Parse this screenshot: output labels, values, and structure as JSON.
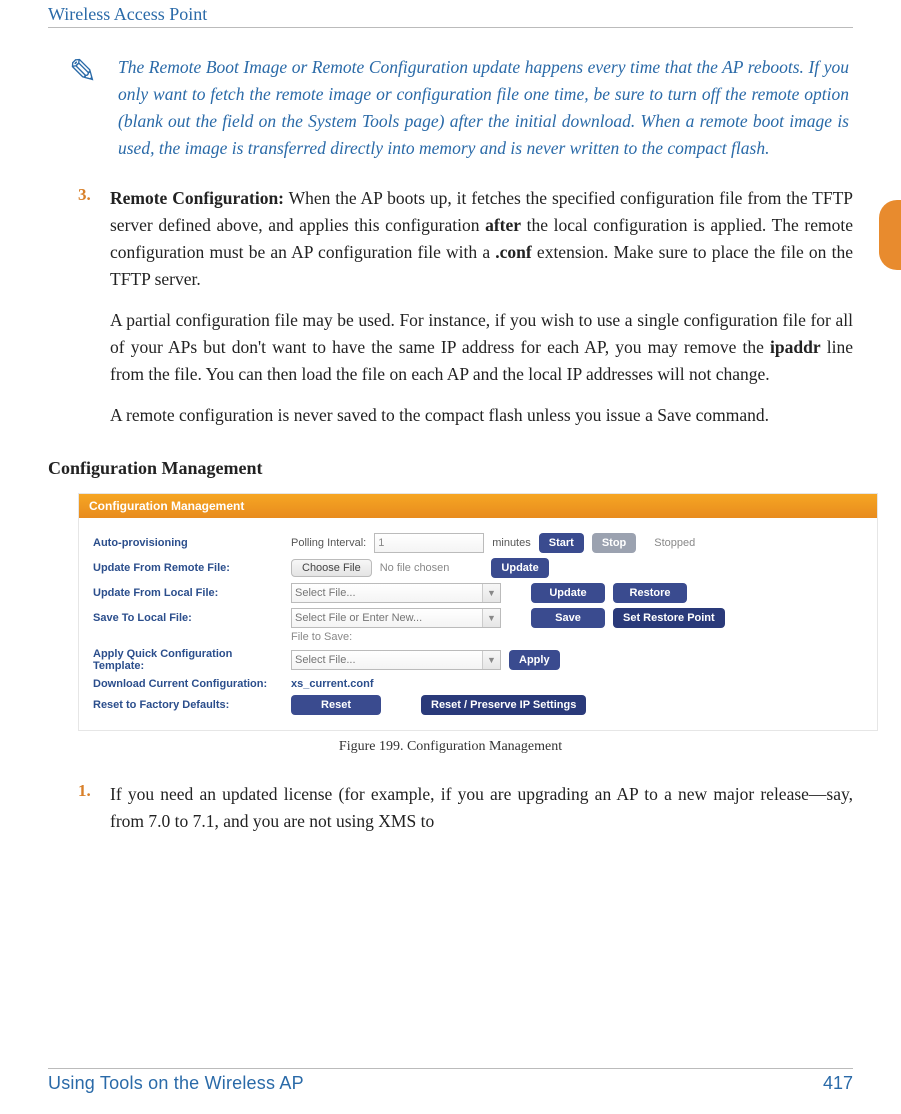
{
  "header": {
    "title": "Wireless Access Point"
  },
  "note": {
    "icon_glyph": "✎",
    "text": "The Remote Boot Image or Remote Configuration update happens every time that the AP reboots. If you only want to fetch the remote image or configuration file one time, be sure to turn off the remote option (blank out the field on the System Tools page) after the initial download. When a remote boot image is used, the image is transferred directly into memory and is never written to the compact flash."
  },
  "item3": {
    "num": "3.",
    "lead": "Remote Configuration:",
    "p1a": " When the AP boots up, it fetches the specified configuration file from the TFTP server defined above, and applies this configuration ",
    "after": "after",
    "p1b": " the local configuration is applied. The remote configuration must be an AP configuration file with a ",
    "conf": ".conf",
    "p1c": " extension. Make sure to place the file on the TFTP server.",
    "p2a": "A partial configuration file may be used. For instance, if you wish to use a single configuration file for all of your APs but don't want to have the same IP address for each AP, you may remove the ",
    "ipaddr": "ipaddr",
    "p2b": " line from the file. You can then load the file on each AP and the local IP addresses will not change.",
    "p3": "A remote configuration is never saved to the compact flash unless you issue a Save command."
  },
  "subhead": "Configuration Management",
  "cm": {
    "panel_title": "Configuration Management",
    "rows": {
      "auto_prov": {
        "label": "Auto-provisioning",
        "polling_label": "Polling Interval:",
        "polling_value": "1",
        "polling_unit": "minutes",
        "start": "Start",
        "stop": "Stop",
        "status": "Stopped"
      },
      "remote": {
        "label": "Update From Remote File:",
        "choose": "Choose File",
        "nofile": "No file chosen",
        "update": "Update"
      },
      "local": {
        "label": "Update From Local File:",
        "placeholder": "Select File...",
        "update": "Update",
        "restore": "Restore"
      },
      "save": {
        "label": "Save To Local File:",
        "placeholder": "Select File or Enter New...",
        "sublabel": "File to Save:",
        "save": "Save",
        "setpoint": "Set Restore Point"
      },
      "apply": {
        "label": "Apply Quick Configuration Template:",
        "placeholder": "Select File...",
        "apply": "Apply"
      },
      "download": {
        "label": "Download Current Configuration:",
        "link": "xs_current.conf"
      },
      "reset": {
        "label": "Reset to Factory Defaults:",
        "reset": "Reset",
        "preserve": "Reset / Preserve IP Settings"
      }
    }
  },
  "figcap": "Figure 199. Configuration Management",
  "item1": {
    "num": "1.",
    "text": "If you need an updated license (for example, if you are upgrading an AP to a new major release—say, from 7.0 to 7.1, and you are not using XMS to"
  },
  "footer": {
    "left": "Using Tools on the Wireless AP",
    "right": "417"
  }
}
